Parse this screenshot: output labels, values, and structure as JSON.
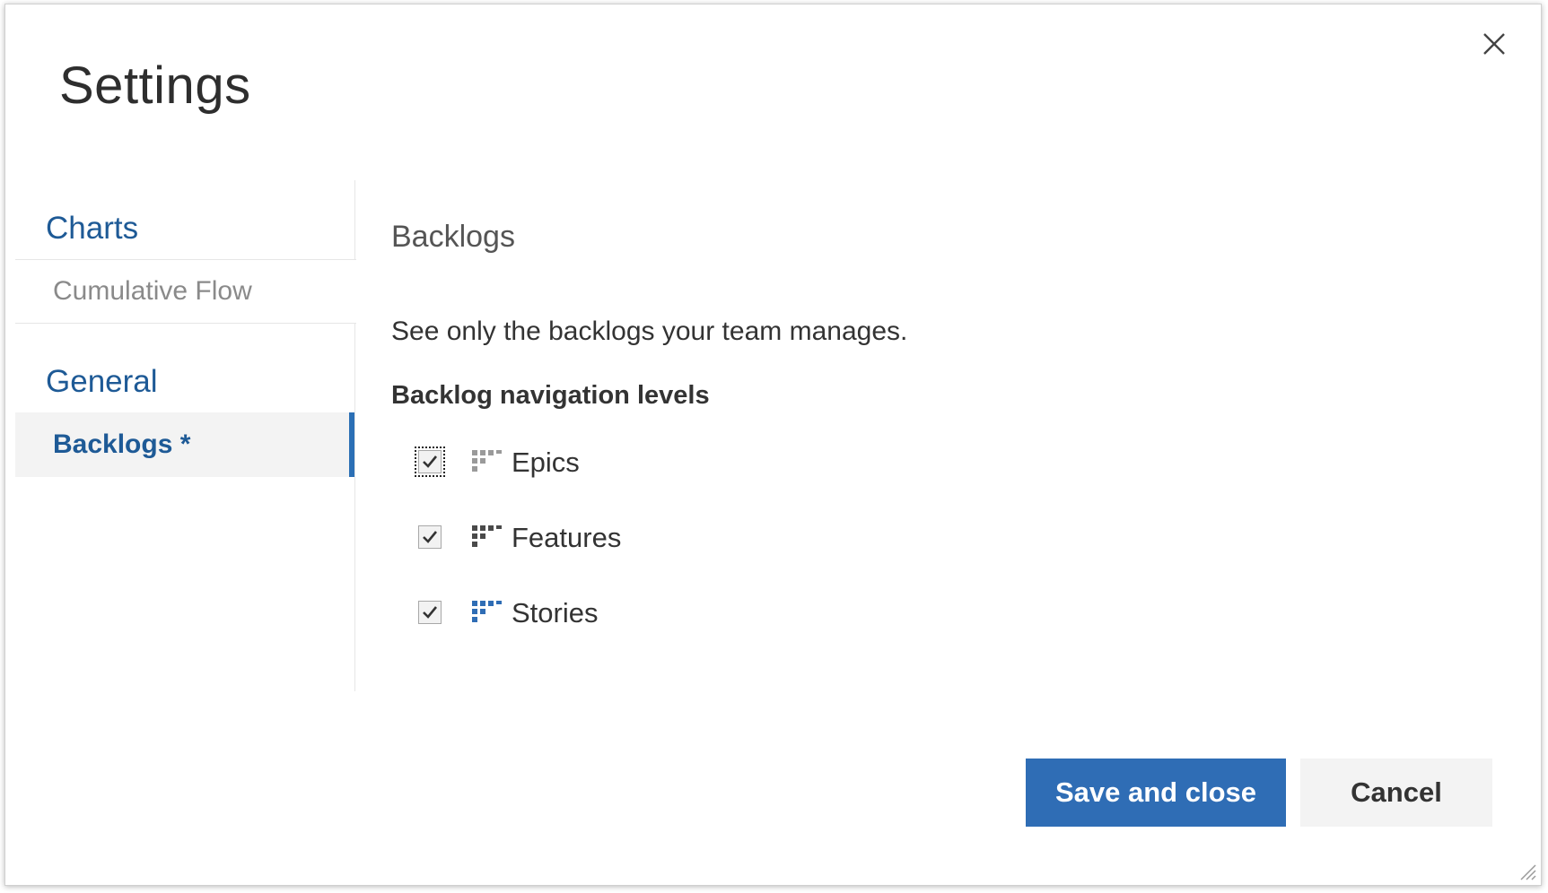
{
  "dialog": {
    "title": "Settings"
  },
  "sidebar": {
    "groups": [
      {
        "header": "Charts",
        "items": [
          {
            "label": "Cumulative Flow",
            "selected": false
          }
        ]
      },
      {
        "header": "General",
        "items": [
          {
            "label": "Backlogs *",
            "selected": true
          }
        ]
      }
    ]
  },
  "content": {
    "section_title": "Backlogs",
    "description": "See only the backlogs your team manages.",
    "levels_label": "Backlog navigation levels",
    "levels": [
      {
        "label": "Epics",
        "checked": true,
        "icon": "backlog-epics-icon",
        "icon_color": "#9a9a9a"
      },
      {
        "label": "Features",
        "checked": true,
        "icon": "backlog-features-icon",
        "icon_color": "#4a4a4a"
      },
      {
        "label": "Stories",
        "checked": true,
        "icon": "backlog-stories-icon",
        "icon_color": "#2f6db5"
      }
    ]
  },
  "footer": {
    "save_label": "Save and close",
    "cancel_label": "Cancel"
  },
  "colors": {
    "accent": "#2f6db5",
    "link": "#1e5a96"
  }
}
